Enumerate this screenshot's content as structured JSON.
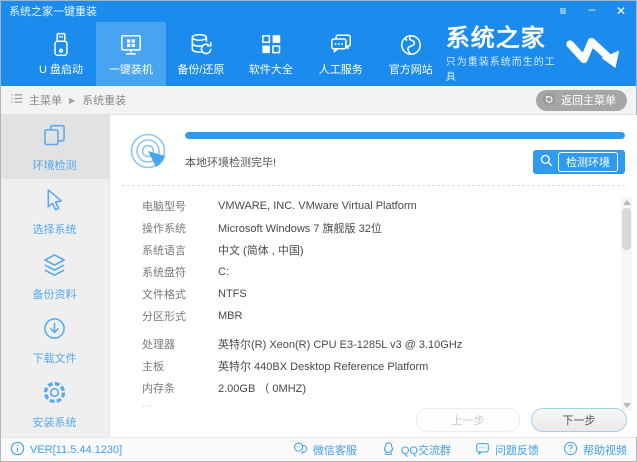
{
  "window": {
    "title": "系统之家一键重装",
    "controls": {
      "menu": "≡",
      "minimize": "–",
      "close": "✕"
    }
  },
  "nav": {
    "items": [
      {
        "label": "U 盘启动"
      },
      {
        "label": "一键装机"
      },
      {
        "label": "备份/还原"
      },
      {
        "label": "软件大全"
      },
      {
        "label": "人工服务"
      },
      {
        "label": "官方网站"
      }
    ],
    "active_index": 1,
    "logo": {
      "title": "系统之家",
      "slogan": "只为重装系统而生的工具"
    }
  },
  "breadcrumb": {
    "root": "主菜单",
    "separator": "▶",
    "current": "系统重装",
    "back_button": "返回主菜单"
  },
  "sidebar": {
    "items": [
      {
        "label": "环境检测"
      },
      {
        "label": "选择系统"
      },
      {
        "label": "备份资料"
      },
      {
        "label": "下载文件"
      },
      {
        "label": "安装系统"
      }
    ],
    "active_index": 0
  },
  "detection": {
    "status_text": "本地环境检测完毕!",
    "detect_button": "检测环境",
    "progress_percent": 100,
    "rows": [
      {
        "label": "电脑型号",
        "value": "VMWARE, INC. VMware Virtual Platform"
      },
      {
        "label": "操作系统",
        "value": "Microsoft Windows 7 旗舰版  32位"
      },
      {
        "label": "系统语言",
        "value": "中文 (简体 , 中国)"
      },
      {
        "label": "系统盘符",
        "value": "C:"
      },
      {
        "label": "文件格式",
        "value": "NTFS"
      },
      {
        "label": "分区形式",
        "value": "MBR"
      },
      {
        "label": "处理器",
        "value": "英特尔(R) Xeon(R) CPU E3-1285L v3 @ 3.10GHz"
      },
      {
        "label": "主板",
        "value": "英特尔 440BX Desktop Reference Platform"
      },
      {
        "label": "内存条",
        "value": "2.00GB （ 0MHZ)"
      }
    ],
    "partial_row": "···"
  },
  "footer_nav": {
    "prev": "上一步",
    "next": "下一步"
  },
  "statusbar": {
    "version": "VER[11.5.44.1230]",
    "links": [
      {
        "label": "微信客服"
      },
      {
        "label": "QQ交流群"
      },
      {
        "label": "问题反馈"
      },
      {
        "label": "帮助视频"
      }
    ]
  },
  "colors": {
    "header_blue": "#1b8cee",
    "nav_active_blue": "#47a4f2",
    "accent_blue": "#2f9bf0",
    "sidebar_blue": "#5aa9ef",
    "back_button_gray": "#a6a6a6"
  }
}
